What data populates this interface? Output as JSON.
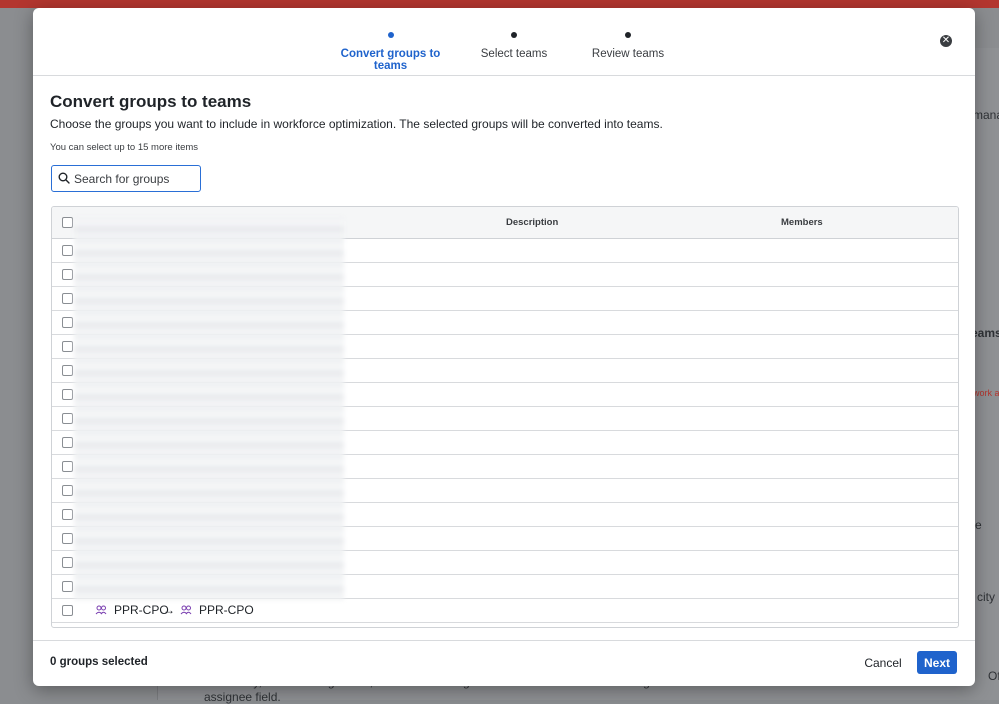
{
  "stepper": {
    "steps": [
      {
        "label": "Convert groups to teams",
        "active": true
      },
      {
        "label": "Select teams",
        "active": false
      },
      {
        "label": "Review teams",
        "active": false
      }
    ],
    "close_icon": "close-icon"
  },
  "header": {
    "title": "Convert groups to teams",
    "subtitle": "Choose the groups you want to include in workforce optimization. The selected groups will be converted into teams.",
    "limit_note": "You can select up to 15 more items"
  },
  "search": {
    "placeholder": "Search for groups",
    "value": "",
    "icon": "search-icon"
  },
  "table": {
    "columns": {
      "description": "Description",
      "members": "Members"
    },
    "visible_row": {
      "from_name": "PPR-CPO",
      "arrow": "→",
      "to_name": "PPR-CPO",
      "from_icon": "group-icon",
      "to_icon": "team-icon"
    }
  },
  "footer": {
    "selected_count": "0 groups selected",
    "cancel_label": "Cancel",
    "next_label": "Next"
  },
  "background": {
    "right_snippets": [
      "manag",
      "eams",
      "work a",
      "e",
      "city",
      "Of"
    ],
    "bottom_text": "availability, or auto-assign is off, recommended agents will be shown when selecting the",
    "bottom_text2": "assignee field."
  },
  "colors": {
    "accent": "#1f63cc",
    "topbar": "#b3362f",
    "overlay": "#8b8d90"
  }
}
